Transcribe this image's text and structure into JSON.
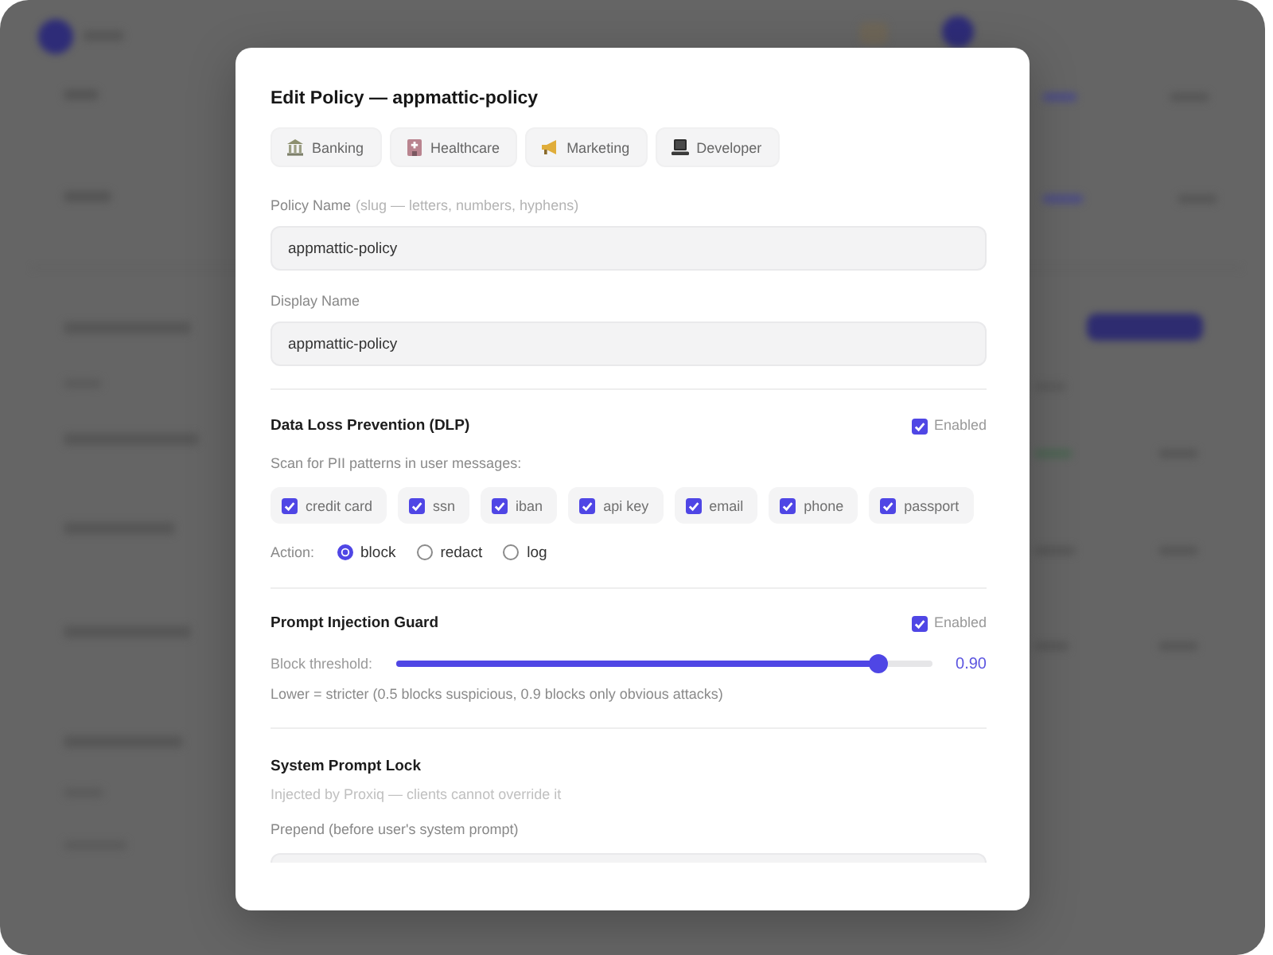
{
  "dialog": {
    "title": "Edit Policy — appmattic-policy",
    "templates": [
      {
        "label": "Banking"
      },
      {
        "label": "Healthcare"
      },
      {
        "label": "Marketing"
      },
      {
        "label": "Developer"
      }
    ],
    "fields": [
      {
        "label": "Policy Name",
        "hint": "(slug — letters, numbers, hyphens)",
        "value": "appmattic-policy"
      },
      {
        "label": "Display Name",
        "value": "appmattic-policy"
      }
    ],
    "dlp": {
      "title": "Data Loss Prevention (DLP)",
      "enabled": {
        "label": "Enabled",
        "checked": true
      },
      "description": "Scan for PII patterns in user messages:",
      "patterns": [
        {
          "label": "credit card",
          "checked": true
        },
        {
          "label": "ssn",
          "checked": true
        },
        {
          "label": "iban",
          "checked": true
        },
        {
          "label": "api key",
          "checked": true
        },
        {
          "label": "email",
          "checked": true
        },
        {
          "label": "phone",
          "checked": true
        },
        {
          "label": "passport",
          "checked": true
        }
      ],
      "action_label": "Action:",
      "actions": [
        {
          "label": "block",
          "selected": true
        },
        {
          "label": "redact",
          "selected": false
        },
        {
          "label": "log",
          "selected": false
        }
      ]
    },
    "injection_guard": {
      "title": "Prompt Injection Guard",
      "enabled": {
        "label": "Enabled",
        "checked": true
      },
      "threshold": {
        "label": "Block threshold:",
        "level": 0.9,
        "reading": "0.90"
      },
      "note": "Lower = stricter (0.5 blocks suspicious, 0.9 blocks only obvious attacks)"
    },
    "system_prompt_lock": {
      "title": "System Prompt Lock",
      "note": "Injected by Proxiq — clients cannot override it",
      "prepend": {
        "label": "Prepend (before user's system prompt)"
      }
    }
  }
}
